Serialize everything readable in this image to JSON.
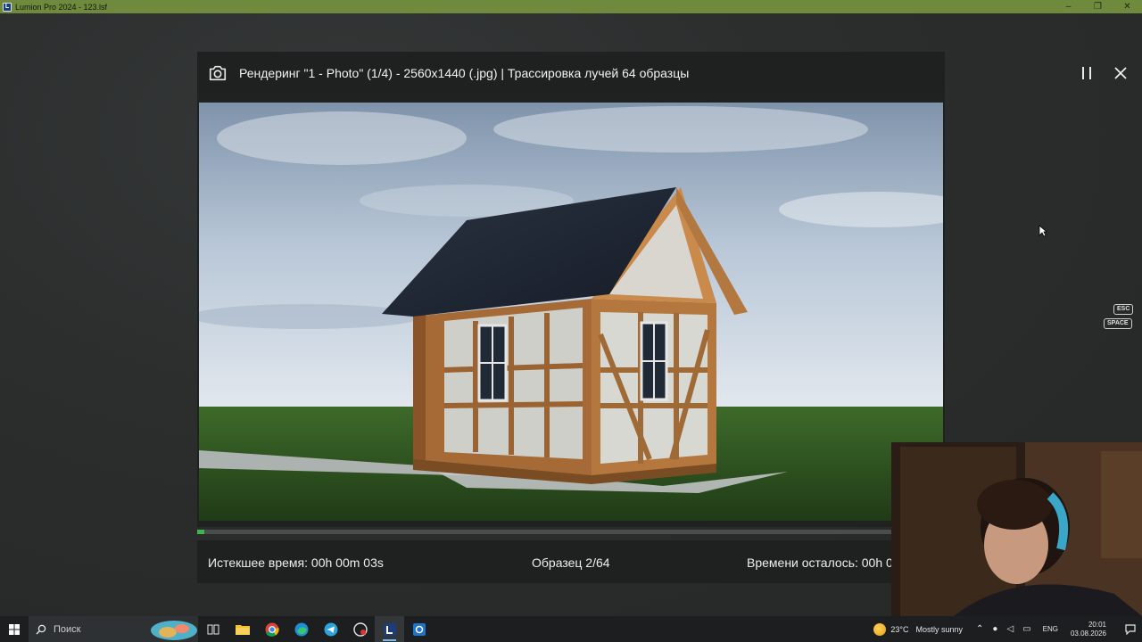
{
  "window": {
    "title": "Lumion Pro 2024 - 123.lsf",
    "minimize_glyph": "–",
    "restore_glyph": "❐",
    "close_glyph": "✕"
  },
  "render_dialog": {
    "title": "Рендеринг \"1 - Photo\" (1/4) - 2560x1440 (.jpg) | Трассировка лучей 64 образцы",
    "icon": "camera-icon",
    "pause_icon": "pause-icon",
    "close_icon": "close-icon",
    "progress": 0.009,
    "elapsed": "Истекшее время: 00h 00m 03s",
    "sample": "Образец 2/64",
    "remaining": "Времени осталось: 00h 0"
  },
  "key_hints": {
    "esc": "ESC",
    "space": "SPACE"
  },
  "taskbar": {
    "search_placeholder": "Поиск",
    "apps": [
      "task-view-icon",
      "file-explorer-icon",
      "chrome-icon",
      "edge-icon",
      "telegram-icon",
      "app-icon",
      "lumion-icon",
      "app-blue-icon"
    ],
    "weather_temp": "23°C",
    "weather_text": "Mostly sunny",
    "language": "ENG",
    "time": "20:01",
    "date": "03.08.2026"
  },
  "colors": {
    "titlebar": "#6f8a3d",
    "progress": "#3fb44a",
    "dialog": "#1f2121"
  }
}
